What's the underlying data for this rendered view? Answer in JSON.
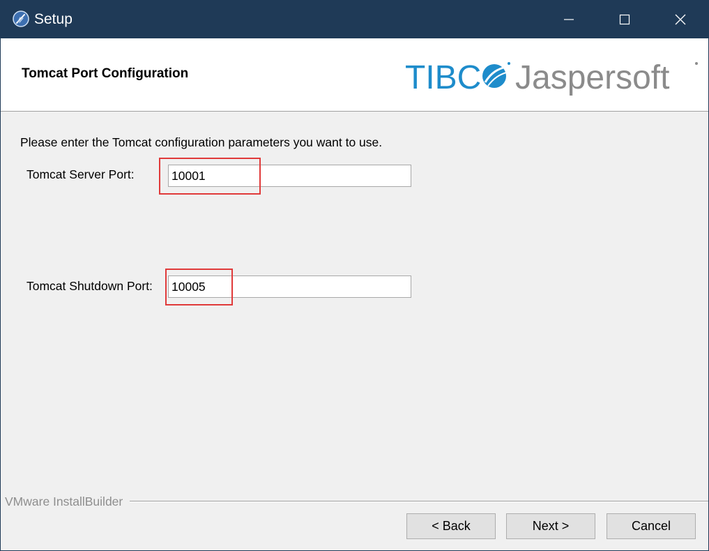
{
  "window": {
    "title": "Setup"
  },
  "header": {
    "title": "Tomcat Port Configuration",
    "logo_primary": "TIBC",
    "logo_secondary": "Jaspersoft"
  },
  "main": {
    "intro": "Please enter the Tomcat configuration parameters you want to use.",
    "server_port": {
      "label": "Tomcat Server Port:",
      "value": "10001"
    },
    "shutdown_port": {
      "label": "Tomcat Shutdown Port:",
      "value": "10005"
    }
  },
  "footer": {
    "brand": "VMware InstallBuilder",
    "back_label": "< Back",
    "next_label": "Next >",
    "cancel_label": "Cancel"
  },
  "icons": {
    "app": "installer-feather-icon",
    "minimize": "minimize-icon",
    "maximize": "maximize-icon",
    "close": "close-icon"
  },
  "colors": {
    "titlebar": "#1f3a57",
    "logo_blue": "#1e8ccb",
    "logo_gray": "#8b8b8b",
    "highlight": "#e03a3a"
  }
}
